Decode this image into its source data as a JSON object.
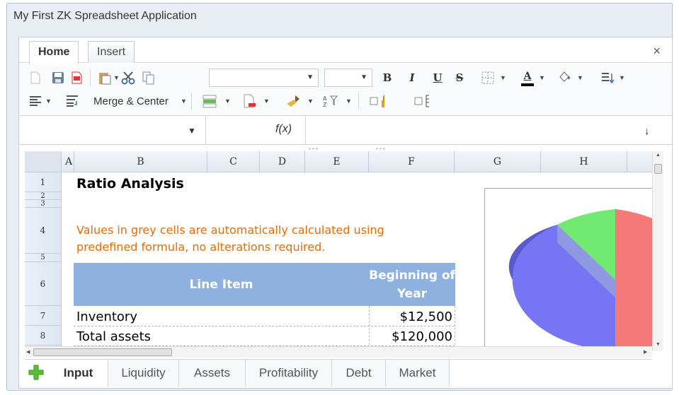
{
  "window": {
    "title": "My First ZK Spreadsheet Application"
  },
  "ribbon": {
    "tabs": [
      "Home",
      "Insert"
    ],
    "active_tab": "Home",
    "close": "×"
  },
  "toolbar": {
    "merge_center_label": "Merge & Center",
    "bold": "B",
    "italic": "I",
    "underline": "U",
    "strike": "S",
    "font_color": "A",
    "font_name_value": "",
    "font_size_value": ""
  },
  "formula_bar": {
    "fx_label": "f(x)",
    "cell_ref": "",
    "formula": ""
  },
  "columns": [
    "A",
    "B",
    "C",
    "D",
    "E",
    "F",
    "G",
    "H"
  ],
  "rows": [
    "1",
    "2",
    "3",
    "4",
    "5",
    "6",
    "7",
    "8"
  ],
  "sheet": {
    "title": "Ratio Analysis",
    "note_line1": "Values in grey cells are automatically calculated using",
    "note_line2": "predefined formula, no alterations required.",
    "header_line_item": "Line Item",
    "header_beginning_line1": "Beginning of",
    "header_beginning_line2": "Year",
    "row7_label": "Inventory",
    "row7_value": "$12,500",
    "row8_label": "Total assets",
    "row8_value": "$120,000"
  },
  "colors": {
    "note": "#e36c09",
    "header_fill": "#8eb1e0",
    "pie_red": "#f46a6a",
    "pie_blue": "#6e6ef5",
    "pie_green": "#6ee86e"
  },
  "sheet_tabs": [
    "Input",
    "Liquidity",
    "Assets",
    "Profitability",
    "Debt",
    "Market"
  ],
  "active_sheet": "Input"
}
